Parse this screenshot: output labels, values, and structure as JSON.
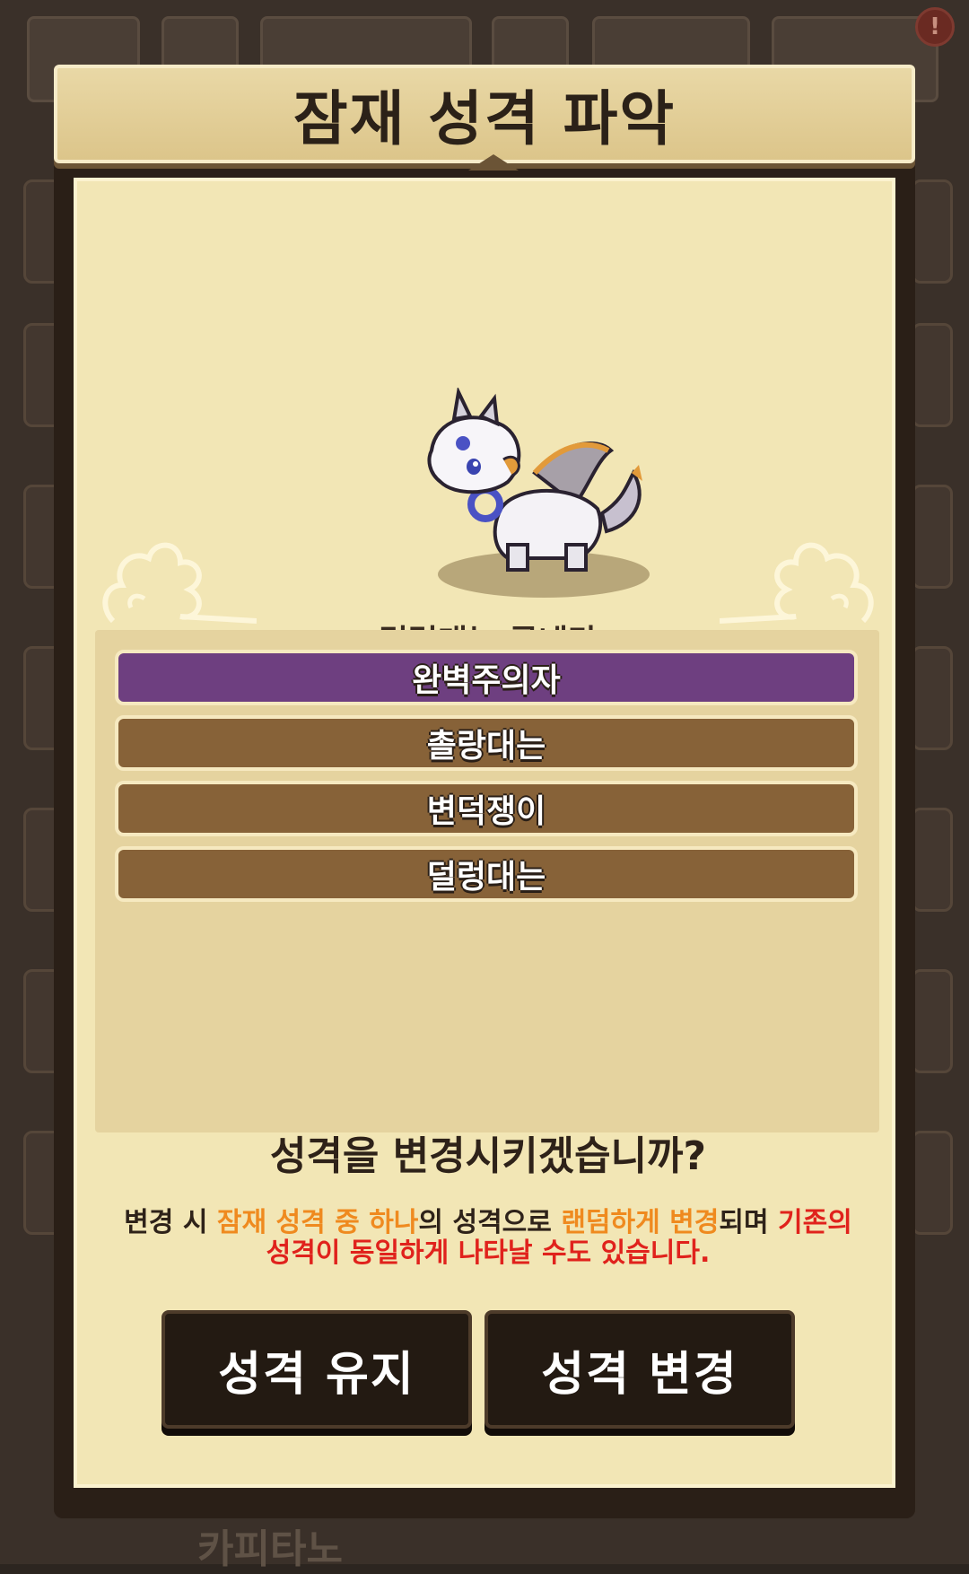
{
  "dialog": {
    "title": "잠재 성격 파악",
    "creature_name": "덜렁대는 루네라",
    "options": [
      {
        "label": "완벽주의자",
        "selected": true
      },
      {
        "label": "촐랑대는",
        "selected": false
      },
      {
        "label": "변덕쟁이",
        "selected": false
      },
      {
        "label": "덜렁대는",
        "selected": false
      }
    ],
    "question": "성격을 변경시키겠습니까?",
    "description": {
      "part1": "변경 시 ",
      "part2": "잠재 성격 중 하나",
      "part3": "의 성격으로 ",
      "part4": "랜덤하게 변경",
      "part5": "되며 ",
      "part6": "기존의 성격이 동일하게 나타날 수도 있습니다."
    },
    "buttons": {
      "keep": "성격 유지",
      "change": "성격 변경"
    }
  },
  "background": {
    "bottom_label": "카피타노",
    "badge": "!"
  },
  "colors": {
    "selected_option": "#6e3f80",
    "option": "#876238",
    "highlight_orange": "#ef8a1f",
    "highlight_red": "#e0221c",
    "panel": "#f2e6b5"
  },
  "icons": {
    "creature": "dragon-creature-sprite",
    "decor": "cloud-swirl-ornament"
  }
}
